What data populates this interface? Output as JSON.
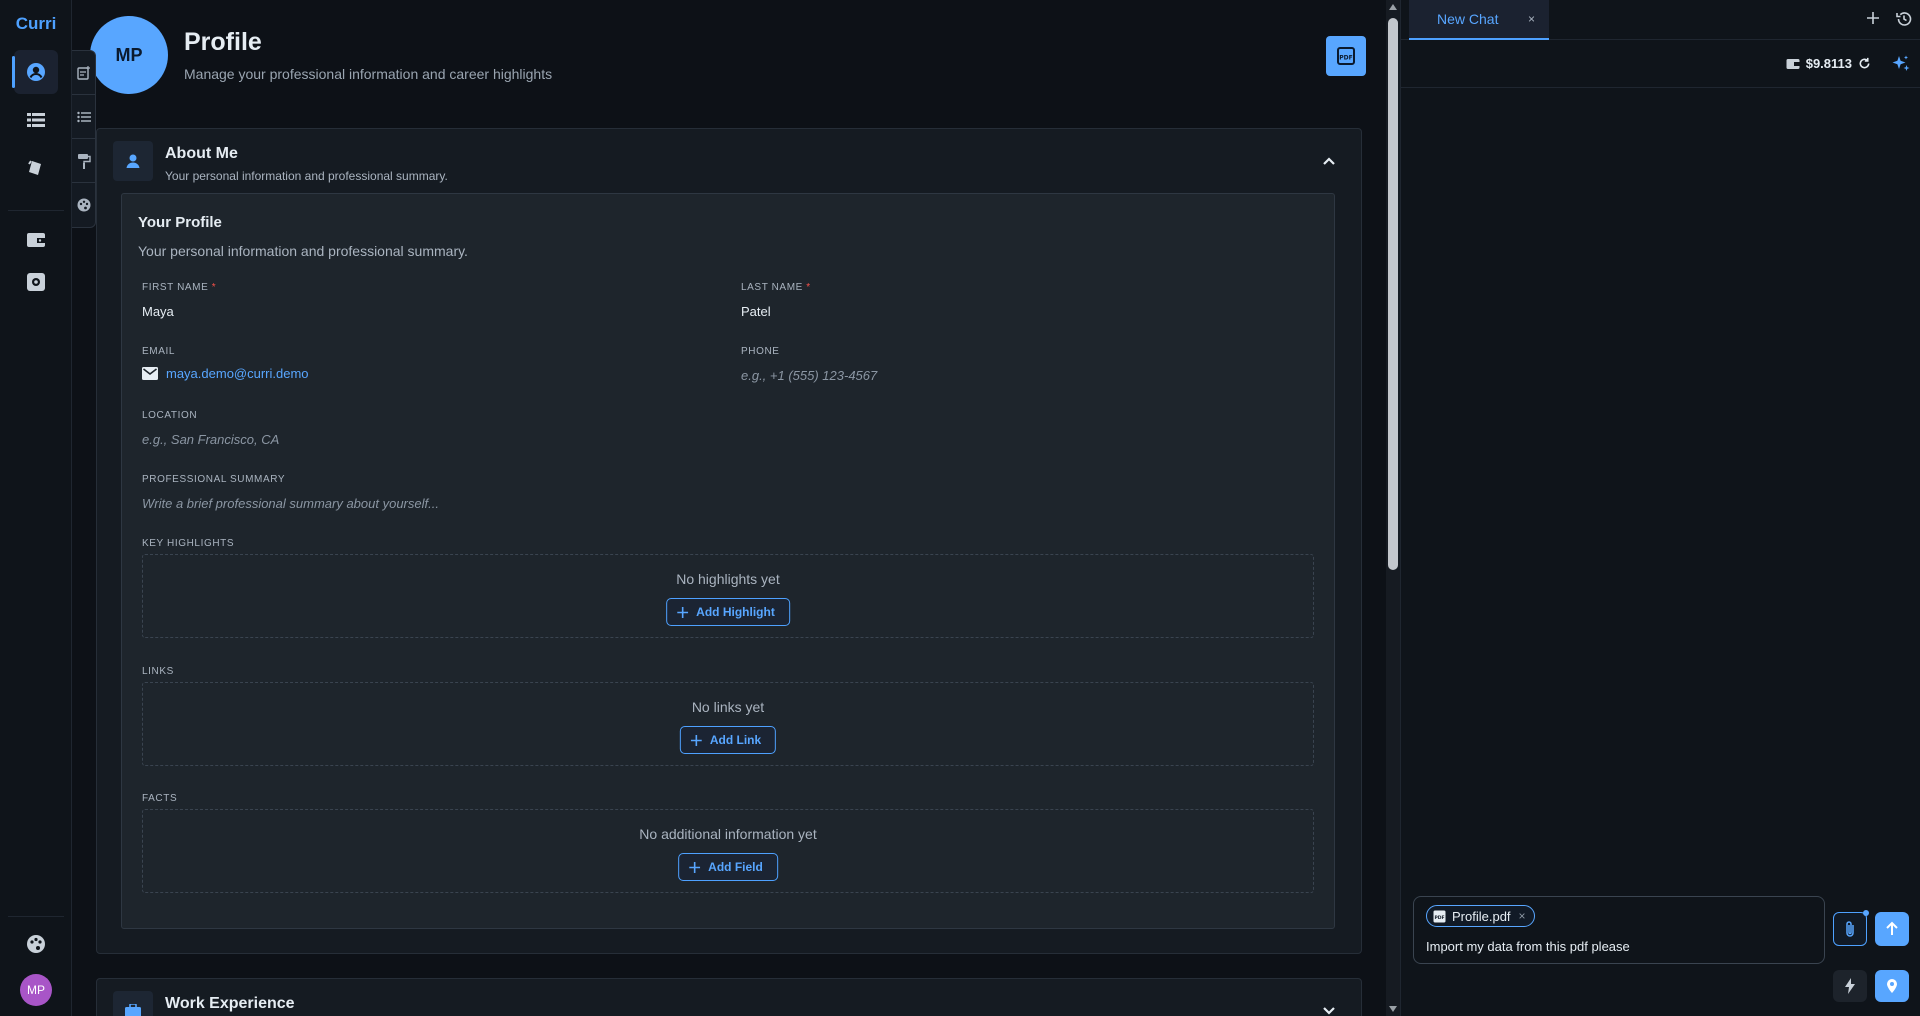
{
  "app": {
    "brand": "Curri"
  },
  "sidebar": {
    "avatar_initials": "MP"
  },
  "header": {
    "avatar_initials": "MP",
    "title": "Profile",
    "subtitle": "Manage your professional information and career highlights"
  },
  "about": {
    "title": "About Me",
    "subtitle": "Your personal information and professional summary.",
    "inner_title": "Your Profile",
    "inner_subtitle": "Your personal information and professional summary.",
    "first_name_label": "FIRST NAME",
    "first_name_value": "Maya",
    "last_name_label": "LAST NAME",
    "last_name_value": "Patel",
    "required_mark": "*",
    "email_label": "EMAIL",
    "email_value": "maya.demo@curri.demo",
    "phone_label": "PHONE",
    "phone_placeholder": "e.g., +1 (555) 123-4567",
    "location_label": "LOCATION",
    "location_placeholder": "e.g., San Francisco, CA",
    "summary_label": "PROFESSIONAL SUMMARY",
    "summary_placeholder": "Write a brief professional summary about yourself...",
    "highlights_label": "KEY HIGHLIGHTS",
    "highlights_empty": "No highlights yet",
    "add_highlight": "Add Highlight",
    "links_label": "LINKS",
    "links_empty": "No links yet",
    "add_link": "Add Link",
    "facts_label": "FACTS",
    "facts_empty": "No additional information yet",
    "add_field": "Add Field"
  },
  "work": {
    "title": "Work Experience"
  },
  "chat": {
    "tab_label": "New Chat",
    "tab_close": "×",
    "balance": "$9.8113",
    "attachment_name": "Profile.pdf",
    "attachment_close": "×",
    "message": "Import my data from this pdf please"
  },
  "colors": {
    "accent": "#58a6ff",
    "background": "#0d1117",
    "card": "#151b22",
    "required": "#f85149",
    "avatar_purple": "#a855c7"
  }
}
